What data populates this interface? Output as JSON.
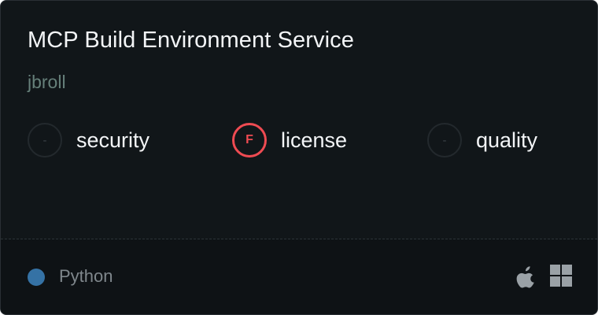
{
  "card": {
    "title": "MCP Build Environment Service",
    "author": "jbroll",
    "metrics": [
      {
        "grade": "-",
        "label": "security"
      },
      {
        "grade": "F",
        "label": "license"
      },
      {
        "grade": "-",
        "label": "quality"
      }
    ],
    "language": {
      "name": "Python",
      "color": "#3572a5"
    },
    "platforms": [
      "apple-icon",
      "windows-icon"
    ],
    "colors": {
      "background": "#111619",
      "footer": "#0e1215",
      "fail_grade": "#ef4b52",
      "author": "#66807a"
    }
  }
}
